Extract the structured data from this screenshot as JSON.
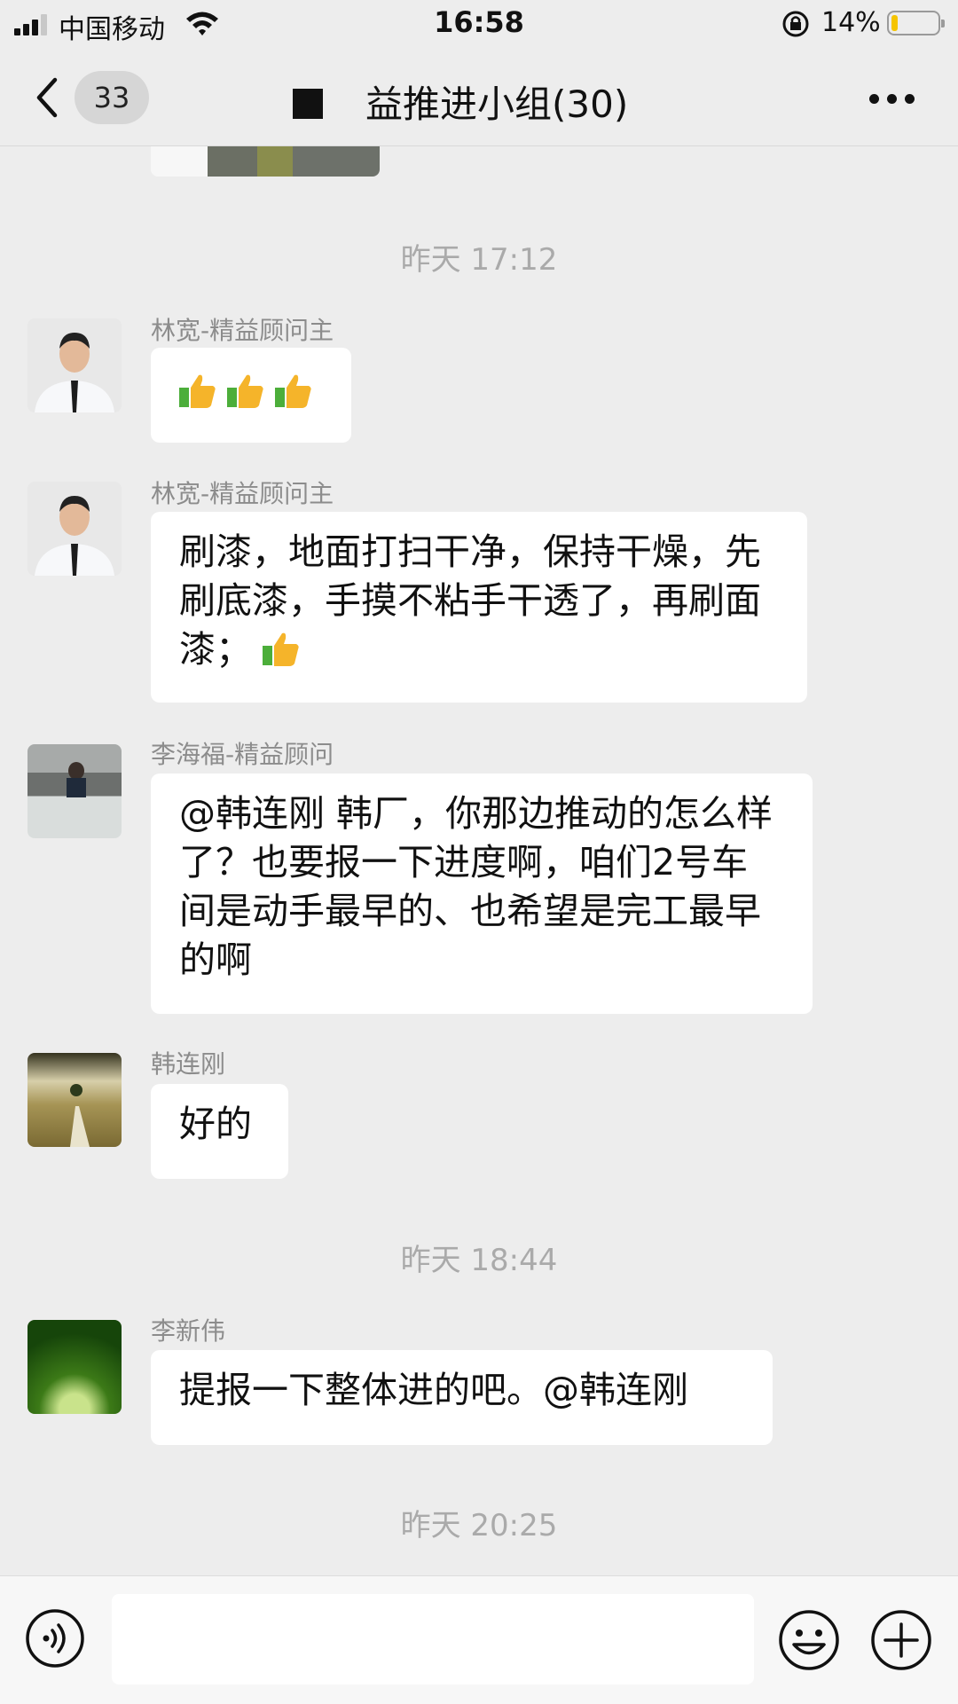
{
  "status_bar": {
    "carrier": "中国移动",
    "time": "16:58",
    "battery_percent": "14%",
    "battery_level": 0.14,
    "signal_bars": 3
  },
  "nav": {
    "unread_count": "33",
    "title": "益推进小组(30)"
  },
  "messages": [
    {
      "type": "timestamp",
      "text": "昨天 17:12"
    },
    {
      "type": "message",
      "sender": "林宽-精益顾问主",
      "text": "",
      "emoji_count": 3
    },
    {
      "type": "message",
      "sender": "林宽-精益顾问主",
      "text": "刷漆，地面打扫干净，保持干燥，先刷底漆，手摸不粘手干透了，再刷面漆；",
      "emoji_count": 1
    },
    {
      "type": "message",
      "sender": "李海福-精益顾问",
      "text": "@韩连刚 韩厂，你那边推动的怎么样了？也要报一下进度啊，咱们2号车间是动手最早的、也希望是完工最早的啊"
    },
    {
      "type": "message",
      "sender": "韩连刚",
      "text": "好的"
    },
    {
      "type": "timestamp",
      "text": "昨天 18:44"
    },
    {
      "type": "message",
      "sender": "李新伟",
      "text": "提报一下整体进的吧。@韩连刚"
    },
    {
      "type": "timestamp",
      "text": "昨天 20:25"
    }
  ],
  "input": {
    "value": "",
    "placeholder": ""
  },
  "icons": {
    "back": "back-chevron-icon",
    "more": "more-dots-icon",
    "voice": "voice-icon",
    "emoji": "emoji-icon",
    "plus": "plus-icon",
    "thumbs_up": "thumbs-up-icon"
  },
  "colors": {
    "background": "#ededed",
    "bubble": "#ffffff",
    "timestamp": "#aaaaaa",
    "sender": "#8c8c8c",
    "battery_fill": "#f5c400"
  }
}
